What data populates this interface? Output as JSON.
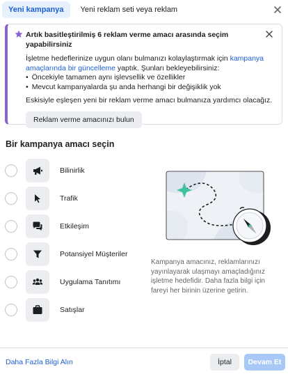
{
  "tabs": [
    {
      "label": "Yeni kampanya",
      "active": true
    },
    {
      "label": "Yeni reklam seti veya reklam",
      "active": false
    }
  ],
  "notice": {
    "title": "Artık basitleştirilmiş 6 reklam verme amacı arasında seçim yapabilirsiniz",
    "body_before_link": "İşletme hedeflerinize uygun olanı bulmanızı kolaylaştırmak için ",
    "link": "kampanya amaçlarında bir güncelleme",
    "body_after_link": " yaptık. Şunları bekleyebilirsiniz:",
    "bullets": [
      "Öncekiyle tamamen aynı işlevsellik ve özellikler",
      "Mevcut kampanyalarda şu anda herhangi bir değişiklik yok"
    ],
    "hint": "Eskisiyle eşleşen yeni bir reklam verme amacı bulmanıza yardımcı olacağız.",
    "button_label": "Reklam verme amacınızı bulun",
    "accent_color": "#8a63d2"
  },
  "section_title": "Bir kampanya amacı seçin",
  "objectives": [
    {
      "label": "Bilinirlik",
      "icon": "megaphone-icon"
    },
    {
      "label": "Trafik",
      "icon": "cursor-icon"
    },
    {
      "label": "Etkileşim",
      "icon": "chat-bubbles-icon"
    },
    {
      "label": "Potansiyel Müşteriler",
      "icon": "funnel-icon"
    },
    {
      "label": "Uygulama Tanıtımı",
      "icon": "people-icon"
    },
    {
      "label": "Satışlar",
      "icon": "briefcase-icon"
    }
  ],
  "description": "Kampanya amacınız, reklamlarınızı yayınlayarak ulaşmayı amaçladığınız işletme hedefidir. Daha fazla bilgi için fareyi her birinin üzerine getirin.",
  "footer": {
    "learn_more": "Daha Fazla Bilgi Alın",
    "cancel": "İptal",
    "continue": "Devam Et"
  },
  "colors": {
    "primary": "#1b5fd6",
    "primary_disabled": "#a8c8f7",
    "illustration_teal": "#3ec2a0"
  }
}
